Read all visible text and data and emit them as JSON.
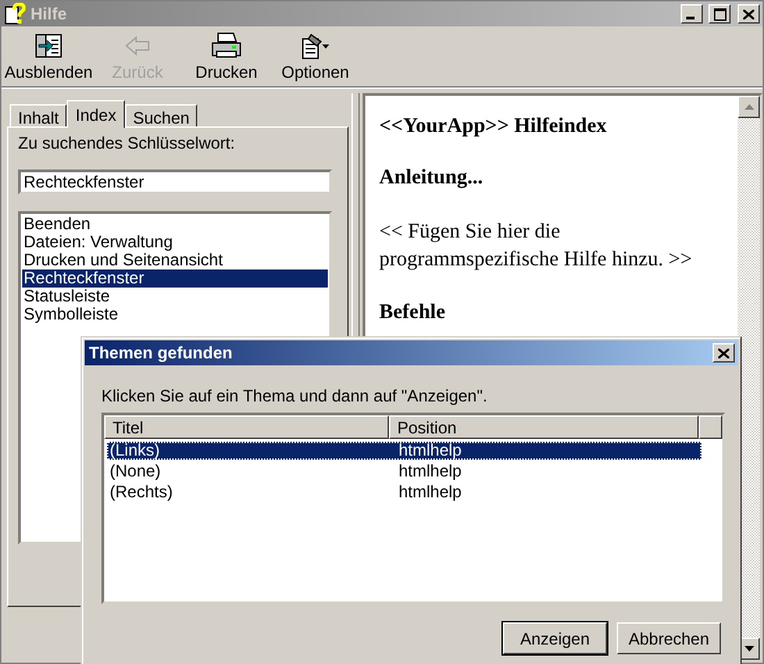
{
  "window": {
    "title": "Hilfe"
  },
  "toolbar": [
    {
      "label": "Ausblenden",
      "kind": "hide",
      "disabled": false
    },
    {
      "label": "Zurück",
      "kind": "back",
      "disabled": true
    },
    {
      "label": "Drucken",
      "kind": "print",
      "disabled": false
    },
    {
      "label": "Optionen",
      "kind": "options",
      "disabled": false
    }
  ],
  "tabs": [
    {
      "label": "Inhalt",
      "selected": false
    },
    {
      "label": "Index",
      "selected": true
    },
    {
      "label": "Suchen",
      "selected": false
    }
  ],
  "keyword": {
    "label": "Zu suchendes Schlüsselwort:",
    "value": "Rechteckfenster"
  },
  "index_items": [
    {
      "label": "Beenden",
      "selected": false
    },
    {
      "label": "Dateien: Verwaltung",
      "selected": false
    },
    {
      "label": "Drucken und Seitenansicht",
      "selected": false
    },
    {
      "label": "Rechteckfenster",
      "selected": true
    },
    {
      "label": "Statusleiste",
      "selected": false
    },
    {
      "label": "Symbolleiste",
      "selected": false
    }
  ],
  "content": [
    {
      "kind": "heading",
      "text": "<<YourApp>> Hilfeindex"
    },
    {
      "kind": "heading",
      "text": "Anleitung..."
    },
    {
      "kind": "paragraph",
      "text": "<< Fügen Sie hier die programmspezifische Hilfe hinzu. >>"
    },
    {
      "kind": "heading",
      "text": "Befehle"
    }
  ],
  "dialog": {
    "title": "Themen gefunden",
    "instruction": "Klicken Sie auf ein Thema und dann auf \"Anzeigen\".",
    "columns": [
      "Titel",
      "Position"
    ],
    "rows": [
      {
        "title": "(Links)",
        "position": "htmlhelp",
        "selected": true
      },
      {
        "title": "(None)",
        "position": "htmlhelp",
        "selected": false
      },
      {
        "title": "(Rechts)",
        "position": "htmlhelp",
        "selected": false
      }
    ],
    "buttons": [
      {
        "label": "Anzeigen",
        "default": true
      },
      {
        "label": "Abbrechen",
        "default": false
      }
    ]
  }
}
